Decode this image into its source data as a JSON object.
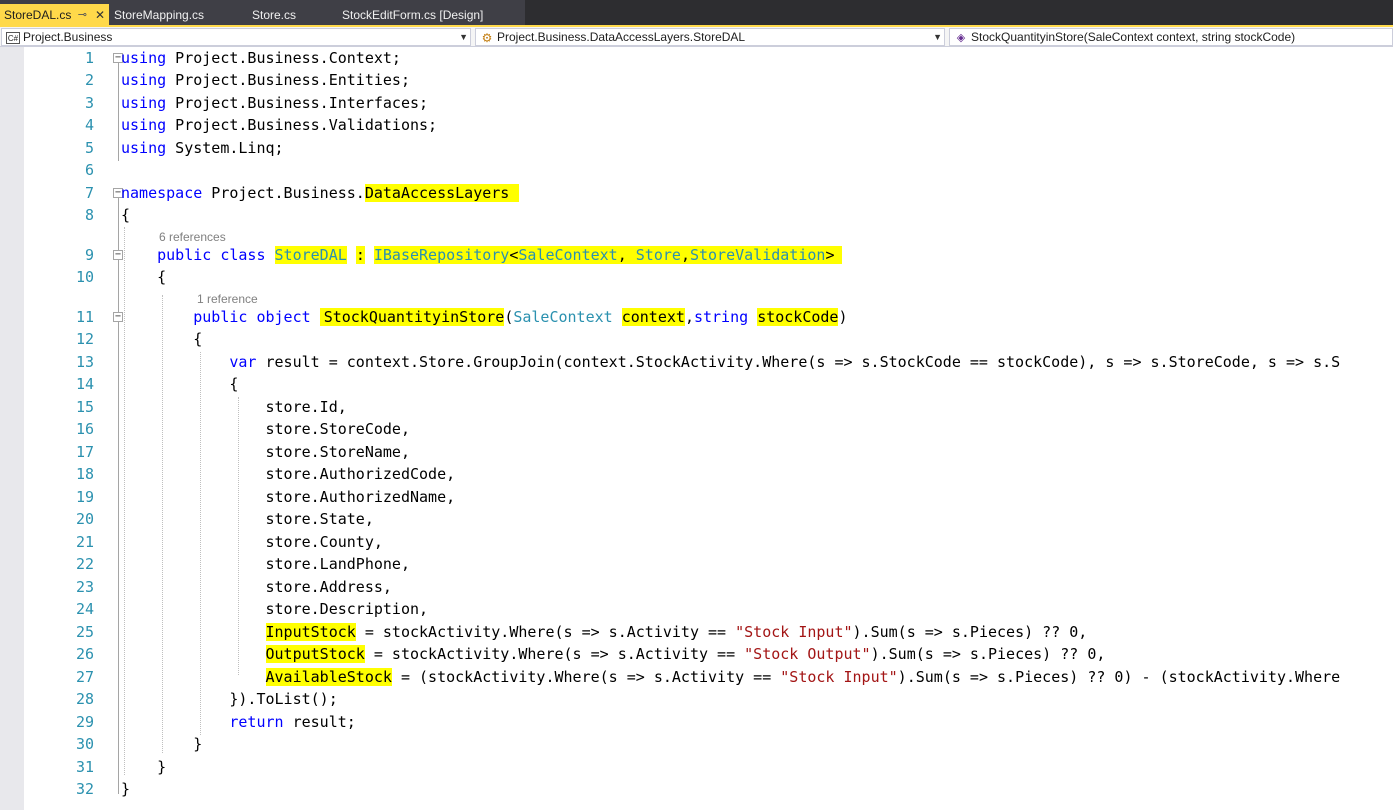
{
  "tabs": [
    {
      "label": "StoreDAL.cs",
      "active": true,
      "pin": "⊸",
      "close": "✕"
    },
    {
      "label": "StoreMapping.cs"
    },
    {
      "label": "Store.cs"
    },
    {
      "label": "StockEditForm.cs [Design]"
    }
  ],
  "navbar": {
    "project": "Project.Business",
    "project_icon": "C#",
    "type": "Project.Business.DataAccessLayers.StoreDAL",
    "member": "StockQuantityinStore(SaleContext context, string stockCode)"
  },
  "codelens": {
    "class_refs": "6 references",
    "method_refs": "1 reference"
  },
  "code": {
    "using_kw": "using",
    "u1": " Project.Business.Context;",
    "u2": " Project.Business.Entities;",
    "u3": " Project.Business.Interfaces;",
    "u4": " Project.Business.Validations;",
    "u5": " System.Linq;",
    "ns_kw": "namespace",
    "ns_prefix": " Project.Business.",
    "ns_hl": "DataAccessLayers",
    "brace_open": "{",
    "brace_close": "}",
    "public_kw": "public",
    "class_kw": "class",
    "class_name": "StoreDAL",
    "colon": ":",
    "iface": "IBaseRepository",
    "lt": "<",
    "gt": ">",
    "comma_sp": ", ",
    "comma": ",",
    "t_salecontext": "SaleContext",
    "t_store": "Store",
    "t_storevalidation": "StoreValidation",
    "object_kw": "object",
    "method_name": "StockQuantityinStore",
    "paren_open": "(",
    "paren_close": ")",
    "p_context": "context",
    "string_kw": "string",
    "p_stockcode": "stockCode",
    "var_kw": "var",
    "l13": " result = context.Store.GroupJoin(context.StockActivity.Where(s => s.StockCode == stockCode), s => s.StoreCode, s => s.S",
    "l15": "store.Id,",
    "l16": "store.StoreCode,",
    "l17": "store.StoreName,",
    "l18": "store.AuthorizedCode,",
    "l19": "store.AuthorizedName,",
    "l20": "store.State,",
    "l21": "store.County,",
    "l22": "store.LandPhone,",
    "l23": "store.Address,",
    "l24": "store.Description,",
    "input_stock": "InputStock",
    "l25_a": " = stockActivity.Where(s => s.Activity == ",
    "str_input": "\"Stock Input\"",
    "l25_b": ").Sum(s => s.Pieces) ?? 0,",
    "output_stock": "OutputStock",
    "l26_a": " = stockActivity.Where(s => s.Activity == ",
    "str_output": "\"Stock Output\"",
    "l26_b": ").Sum(s => s.Pieces) ?? 0,",
    "available_stock": "AvailableStock",
    "l27_a": " = (stockActivity.Where(s => s.Activity == ",
    "l27_b": ").Sum(s => s.Pieces) ?? 0) - (stockActivity.Where",
    "l28": "}).ToList();",
    "return_kw": "return",
    "l29": " result;",
    "line_numbers": [
      "1",
      "2",
      "3",
      "4",
      "5",
      "6",
      "7",
      "8",
      "9",
      "10",
      "11",
      "12",
      "13",
      "14",
      "15",
      "16",
      "17",
      "18",
      "19",
      "20",
      "21",
      "22",
      "23",
      "24",
      "25",
      "26",
      "27",
      "28",
      "29",
      "30",
      "31",
      "32"
    ]
  },
  "colors": {
    "keyword": "#0000ff",
    "type": "#2b91af",
    "string": "#a31515",
    "highlight": "#ffff00",
    "tab_active": "#ffd94a"
  }
}
